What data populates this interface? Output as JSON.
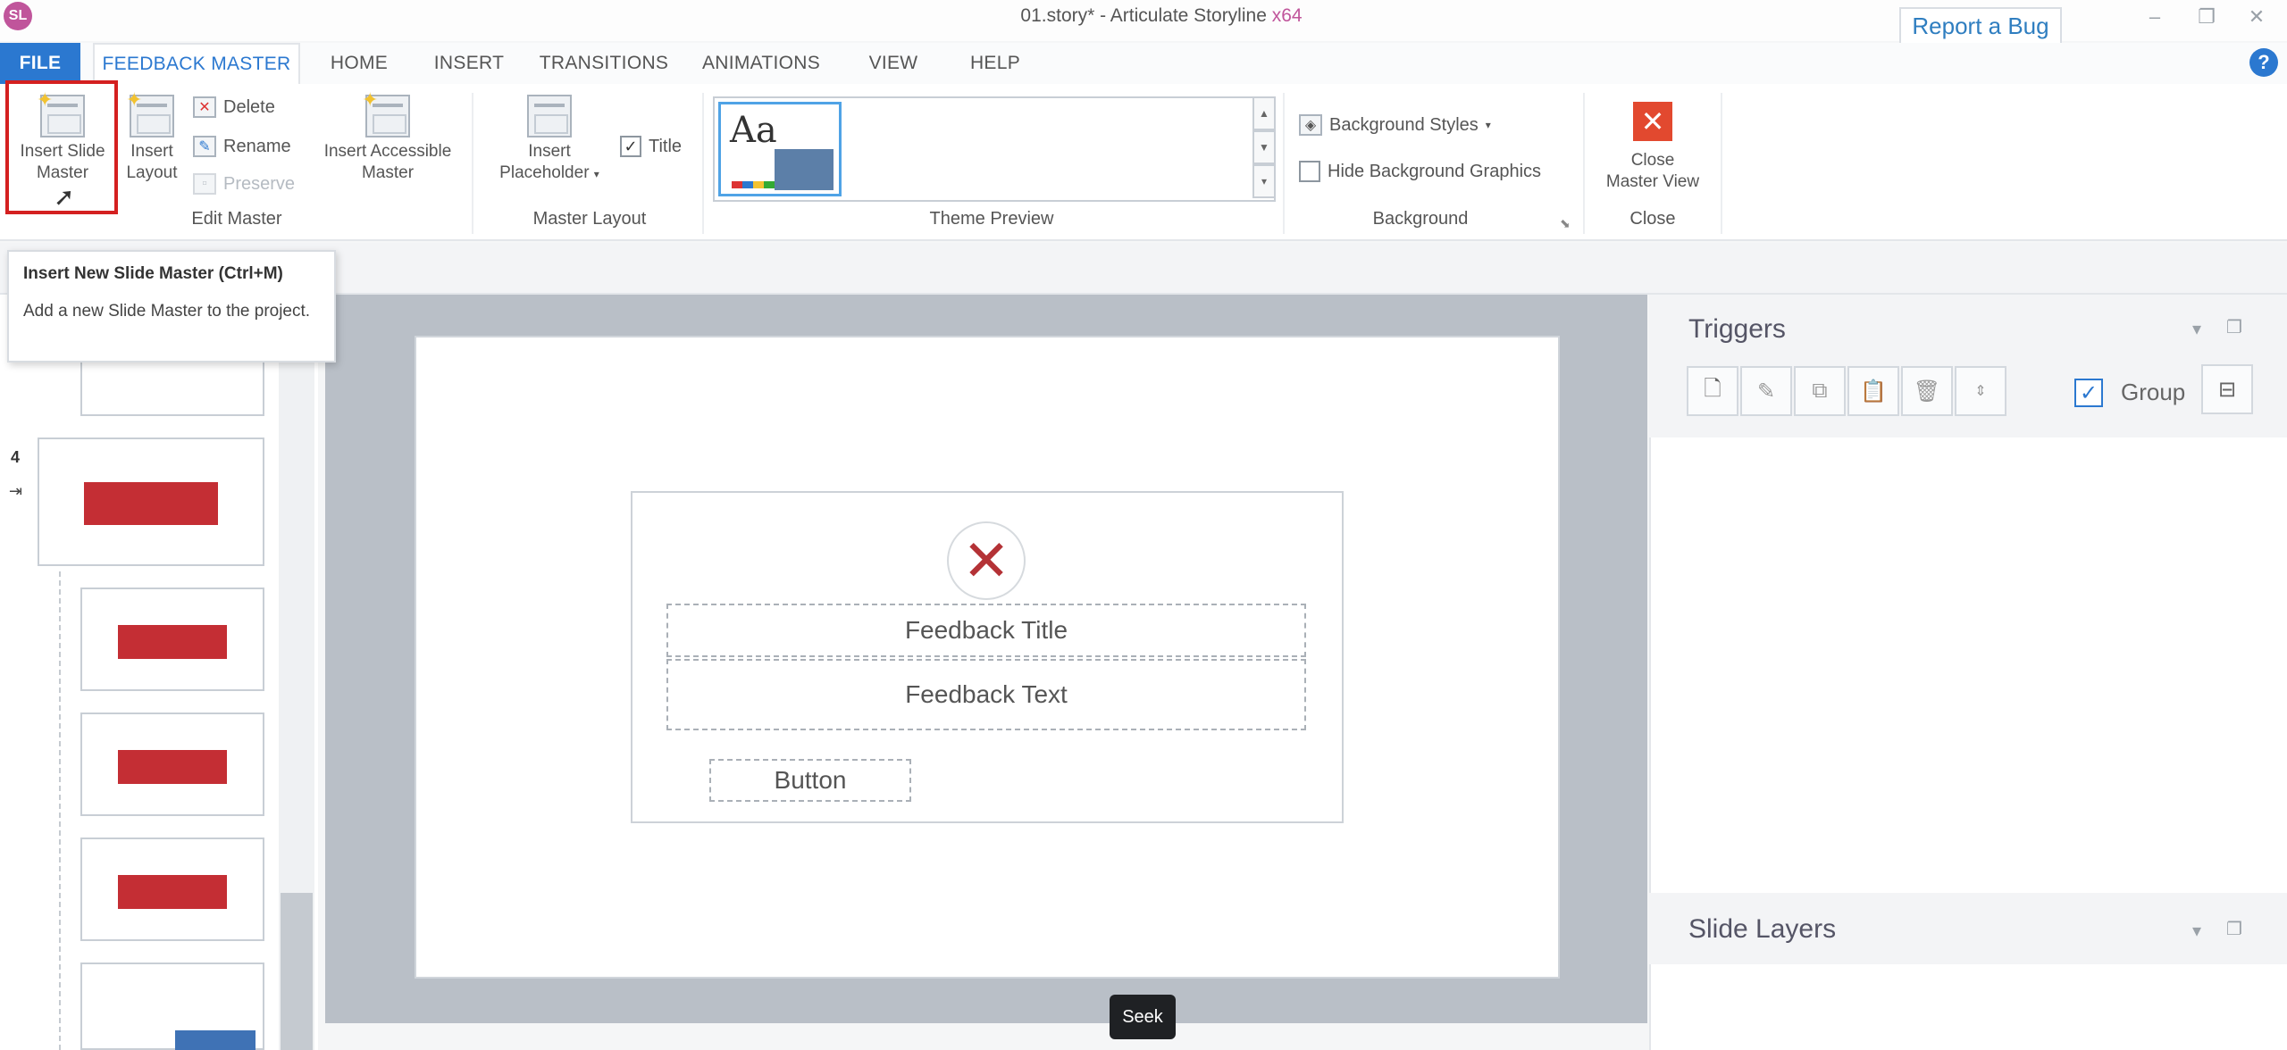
{
  "window": {
    "app_initial": "SL",
    "title": "01.story* -  Articulate Storyline",
    "arch": "x64",
    "report_bug": "Report a Bug",
    "minimize": "–",
    "restore": "❐",
    "close": "✕"
  },
  "tabs": {
    "file": "FILE",
    "feedback_master": "FEEDBACK MASTER",
    "home": "HOME",
    "insert": "INSERT",
    "transitions": "TRANSITIONS",
    "animations": "ANIMATIONS",
    "view": "VIEW",
    "help": "HELP",
    "help_icon": "?"
  },
  "ribbon": {
    "insert_slide_master_l1": "Insert Slide",
    "insert_slide_master_l2": "Master",
    "insert_layout_l1": "Insert",
    "insert_layout_l2": "Layout",
    "delete": "Delete",
    "rename": "Rename",
    "preserve": "Preserve",
    "insert_accessible_l1": "Insert Accessible",
    "insert_accessible_l2": "Master",
    "edit_master_group": "Edit Master",
    "insert_placeholder_l1": "Insert",
    "insert_placeholder_l2": "Placeholder",
    "title_checkbox": "Title",
    "master_layout_group": "Master Layout",
    "theme_aa": "Aa",
    "theme_preview_group": "Theme Preview",
    "background_styles": "Background Styles",
    "hide_background_graphics": "Hide Background Graphics",
    "background_group": "Background",
    "close_master_l1": "Close",
    "close_master_l2": "Master View",
    "close_group": "Close"
  },
  "tooltip": {
    "title": "Insert New Slide Master (Ctrl+M)",
    "description": "Add a new Slide Master to the project."
  },
  "slide_panel": {
    "slide_number": "4"
  },
  "canvas": {
    "feedback_title": "Feedback Title",
    "feedback_text": "Feedback Text",
    "button": "Button",
    "seek_tooltip": "Seek"
  },
  "triggers": {
    "title": "Triggers",
    "group_label": "Group"
  },
  "slide_layers": {
    "title": "Slide Layers"
  }
}
